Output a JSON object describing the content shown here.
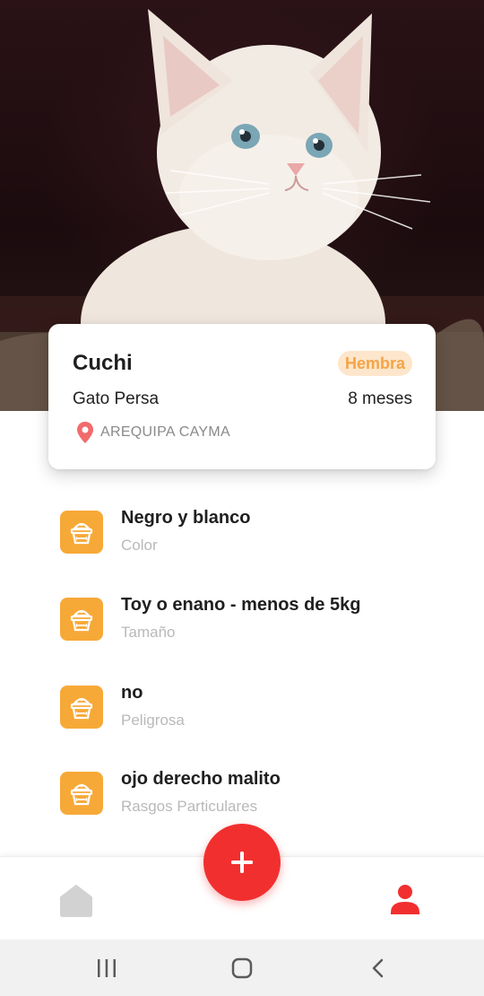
{
  "pet": {
    "name": "Cuchi",
    "gender": "Hembra",
    "breed": "Gato Persa",
    "age": "8 meses",
    "location": "AREQUIPA CAYMA"
  },
  "attributes": [
    {
      "value": "Negro y blanco",
      "label": "Color",
      "icon": "pet-food-bowl-icon"
    },
    {
      "value": "Toy o enano - menos de 5kg",
      "label": "Tamaño",
      "icon": "pet-food-bowl-icon"
    },
    {
      "value": "no",
      "label": "Peligrosa",
      "icon": "pet-food-bowl-icon"
    },
    {
      "value": "ojo derecho malito",
      "label": "Rasgos Particulares",
      "icon": "pet-food-bowl-icon"
    }
  ],
  "nav": {
    "home_icon": "home-icon",
    "add_icon": "plus-icon",
    "profile_icon": "user-icon"
  },
  "colors": {
    "accent_orange": "#f7a938",
    "badge_bg": "#fde6cc",
    "badge_text": "#f5a445",
    "fab_red": "#f22f2f",
    "pin_red": "#f26b6b",
    "active_nav": "#f22f2f",
    "inactive_nav": "#cfcfcf"
  }
}
